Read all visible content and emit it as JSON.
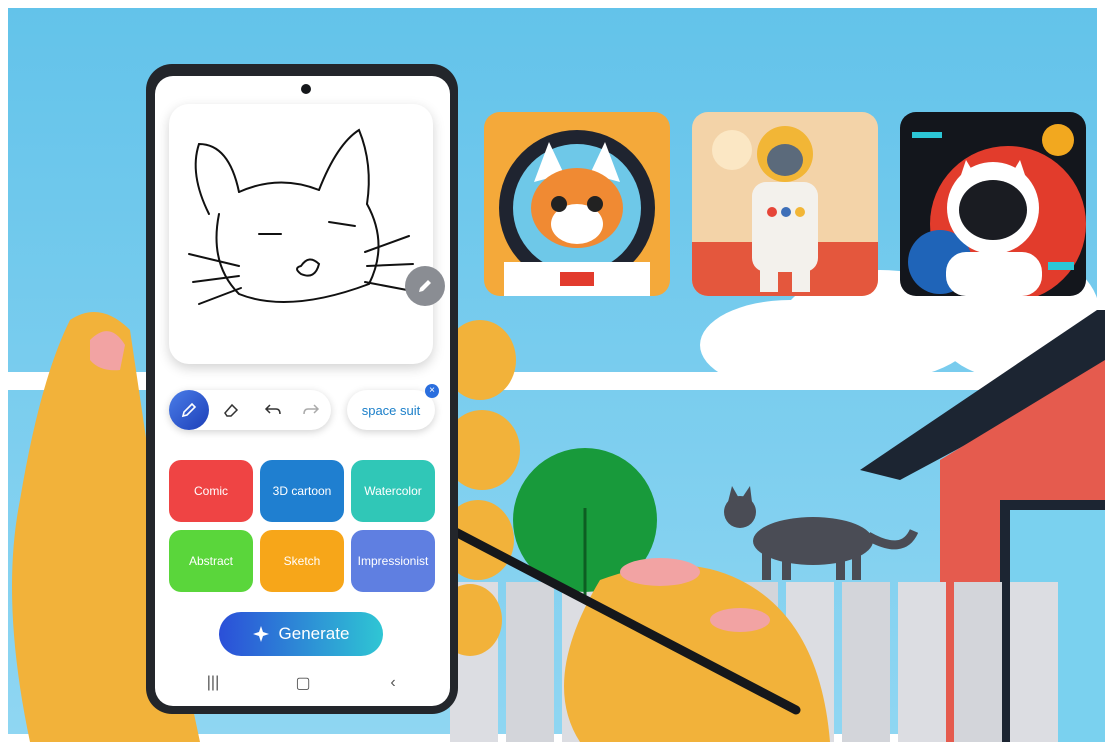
{
  "toolbar": {
    "pen_icon": "pen-icon",
    "eraser_icon": "eraser-icon",
    "undo_icon": "undo-icon",
    "redo_icon": "redo-icon"
  },
  "prompt": {
    "text": "space suit"
  },
  "styles": [
    "Comic",
    "3D cartoon",
    "Watercolor",
    "Abstract",
    "Sketch",
    "Impressionist"
  ],
  "style_colors": [
    "#ef4444",
    "#1f7fd0",
    "#30c7b7",
    "#5ad63b",
    "#f7a619",
    "#5f7fe1"
  ],
  "generate": {
    "label": "Generate"
  },
  "navbar": {
    "recents": "|||",
    "home": "▢",
    "back": "‹"
  }
}
